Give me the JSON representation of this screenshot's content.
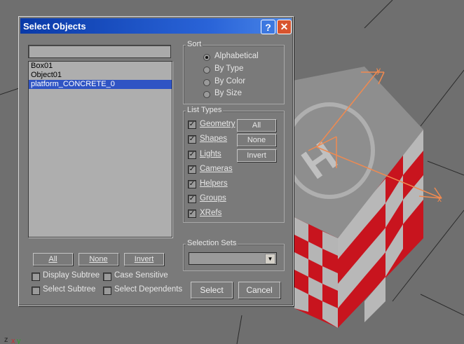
{
  "dialog": {
    "title": "Select Objects",
    "help_glyph": "?",
    "close_glyph": "✕",
    "search_value": "",
    "objects": [
      "Box01",
      "Object01",
      "platform_CONCRETE_0"
    ],
    "selected_index": 2,
    "list_buttons": {
      "all": "All",
      "none": "None",
      "invert": "Invert"
    },
    "options": {
      "display_subtree": "Display Subtree",
      "case_sensitive": "Case Sensitive",
      "select_subtree": "Select Subtree",
      "select_dependents": "Select Dependents"
    },
    "sort": {
      "label": "Sort",
      "items": [
        "Alphabetical",
        "By Type",
        "By Color",
        "By Size"
      ],
      "selected": "Alphabetical"
    },
    "list_types": {
      "label": "List Types",
      "items": [
        "Geometry",
        "Shapes",
        "Lights",
        "Cameras",
        "Helpers",
        "Groups",
        "XRefs"
      ],
      "all_label": "All",
      "none_label": "None",
      "invert_label": "Invert"
    },
    "selection_sets": {
      "label": "Selection Sets",
      "value": ""
    },
    "select_button": "Select",
    "cancel_button": "Cancel"
  },
  "viewport": {
    "axis_x": "x",
    "axis_y": "y",
    "corner_axes": [
      "z",
      "x",
      "y"
    ]
  },
  "colors": {
    "titlebar": "#2a64d8",
    "selection": "#2f54c4",
    "gizmo": "#f08a50",
    "cube_red": "#c8141e"
  }
}
